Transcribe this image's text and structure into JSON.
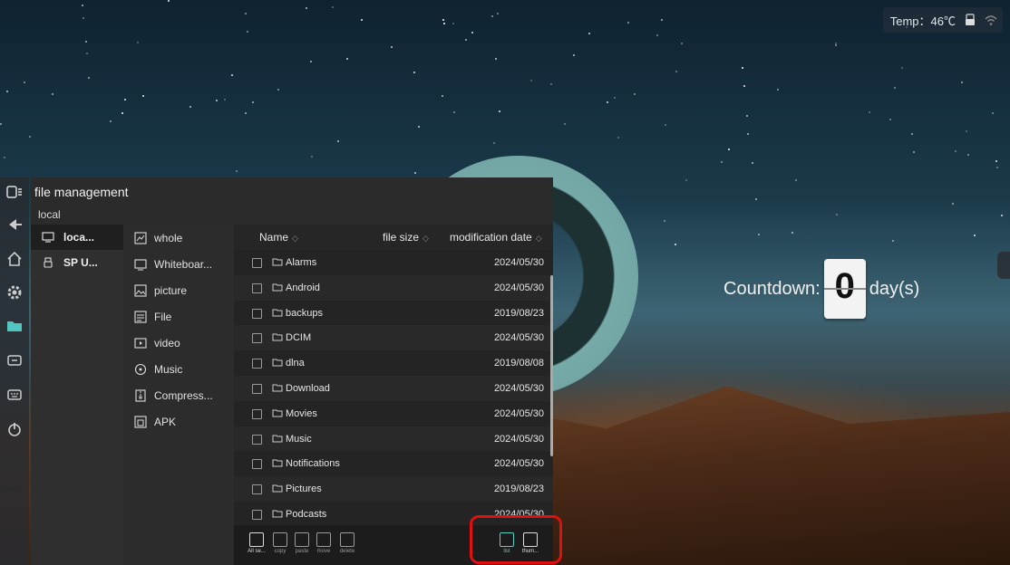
{
  "status": {
    "temp_label": "Temp：46℃"
  },
  "countdown": {
    "label": "Countdown:",
    "value": "0",
    "unit": "day(s)"
  },
  "file_manager": {
    "title": "file management",
    "breadcrumb": "local",
    "storage": [
      {
        "label": "loca...",
        "icon": "monitor-icon",
        "selected": true
      },
      {
        "label": "SP U...",
        "icon": "usb-icon",
        "selected": false
      }
    ],
    "categories": [
      {
        "label": "whole",
        "icon": "whole-icon"
      },
      {
        "label": "Whiteboar...",
        "icon": "whiteboard-icon"
      },
      {
        "label": "picture",
        "icon": "picture-icon"
      },
      {
        "label": "File",
        "icon": "file-icon"
      },
      {
        "label": "video",
        "icon": "video-icon"
      },
      {
        "label": "Music",
        "icon": "music-icon"
      },
      {
        "label": "Compress...",
        "icon": "compress-icon"
      },
      {
        "label": "APK",
        "icon": "apk-icon"
      }
    ],
    "columns": {
      "name": "Name",
      "size": "file size",
      "date": "modification date"
    },
    "files": [
      {
        "name": "Alarms",
        "date": "2024/05/30"
      },
      {
        "name": "Android",
        "date": "2024/05/30"
      },
      {
        "name": "backups",
        "date": "2019/08/23"
      },
      {
        "name": "DCIM",
        "date": "2024/05/30"
      },
      {
        "name": "dlna",
        "date": "2019/08/08"
      },
      {
        "name": "Download",
        "date": "2024/05/30"
      },
      {
        "name": "Movies",
        "date": "2024/05/30"
      },
      {
        "name": "Music",
        "date": "2024/05/30"
      },
      {
        "name": "Notifications",
        "date": "2024/05/30"
      },
      {
        "name": "Pictures",
        "date": "2019/08/23"
      },
      {
        "name": "Podcasts",
        "date": "2024/05/30"
      }
    ],
    "toolbar": {
      "select_all": "All se...",
      "copy": "copy",
      "paste": "paste",
      "move": "move",
      "delete": "delete",
      "list": "list",
      "thumb": "thum..."
    }
  }
}
